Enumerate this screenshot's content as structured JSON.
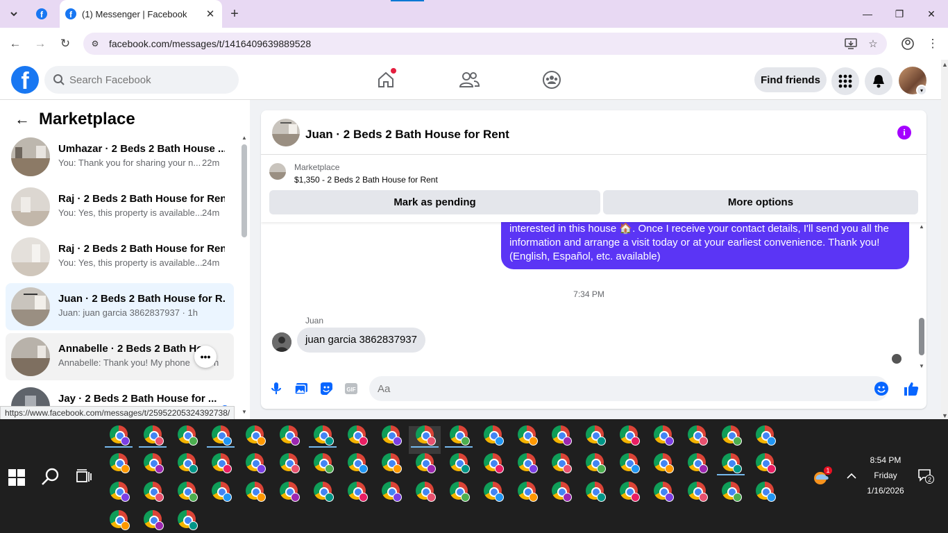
{
  "browser": {
    "tab_title": "(1) Messenger | Facebook",
    "url": "facebook.com/messages/t/1416409639889528",
    "status_url": "https://www.facebook.com/messages/t/25952205324392738/"
  },
  "header": {
    "logo_letter": "f",
    "search_placeholder": "Search Facebook",
    "find_friends_label": "Find friends"
  },
  "sidebar": {
    "title": "Marketplace",
    "conversations": [
      {
        "name": "Umhazar · 2 Beds 2 Bath House ...",
        "snippet": "You: Thank you for sharing your n...",
        "time": "22m"
      },
      {
        "name": "Raj · 2 Beds 2 Bath House for Rent",
        "snippet": "You: Yes, this property is available...",
        "time": "24m"
      },
      {
        "name": "Raj · 2 Beds 2 Bath House for Rent",
        "snippet": "You: Yes, this property is available...",
        "time": "24m"
      },
      {
        "name": "Juan · 2 Beds 2 Bath House for R...",
        "snippet": "Juan: juan garcia 3862837937 · 1h",
        "time": ""
      },
      {
        "name": "Annabelle · 2 Beds 2 Bath Ho...",
        "snippet": "Annabelle: Thank you! My phone",
        "time": "h"
      },
      {
        "name": "Jay · 2 Beds 2 Bath House for ...",
        "snippet": "",
        "time": ""
      }
    ],
    "more_options_glyph": "•••"
  },
  "chat": {
    "title": "Juan · 2 Beds 2 Bath House for Rent",
    "info_glyph": "i",
    "marketplace_label": "Marketplace",
    "listing": "$1,350 - 2 Beds 2 Bath House for Rent",
    "mark_pending_label": "Mark as pending",
    "more_options_label": "More options",
    "outgoing_message": "Yes, this property is available 😊. Please share your contact number 📞 if you're interested in this house 🏠. Once I receive your contact details, I'll send you all the information and arrange a visit today or at your earliest convenience. Thank you! (English, Español, etc. available)",
    "timestamp": "7:34 PM",
    "sender_name": "Juan",
    "incoming_message": "juan garcia 3862837937",
    "composer_placeholder": "Aa",
    "gif_label": "GIF"
  },
  "taskbar": {
    "time": "8:54 PM",
    "day": "Friday",
    "date": "1/16/2026",
    "weather_badge": "1",
    "notification_count": "2"
  },
  "colors": {
    "facebook_blue": "#1877f2",
    "messenger_purple": "#5b35f5",
    "info_purple": "#a400ff",
    "selected_row": "#ebf5ff",
    "tabstrip": "#e8d9f3"
  },
  "icons": [
    "chevron-down-icon",
    "facebook-icon",
    "close-icon",
    "plus-icon",
    "minimize-icon",
    "restore-icon",
    "back-icon",
    "forward-icon",
    "reload-icon",
    "tune-icon",
    "install-icon",
    "star-icon",
    "profile-icon",
    "kebab-icon",
    "search-icon",
    "home-icon",
    "friends-icon",
    "groups-icon",
    "menu-grid-icon",
    "bell-icon",
    "arrow-left-icon",
    "info-icon",
    "mic-icon",
    "photo-icon",
    "sticker-icon",
    "gif-icon",
    "emoji-icon",
    "like-icon",
    "windows-icon",
    "task-view-icon",
    "chrome-icon"
  ]
}
